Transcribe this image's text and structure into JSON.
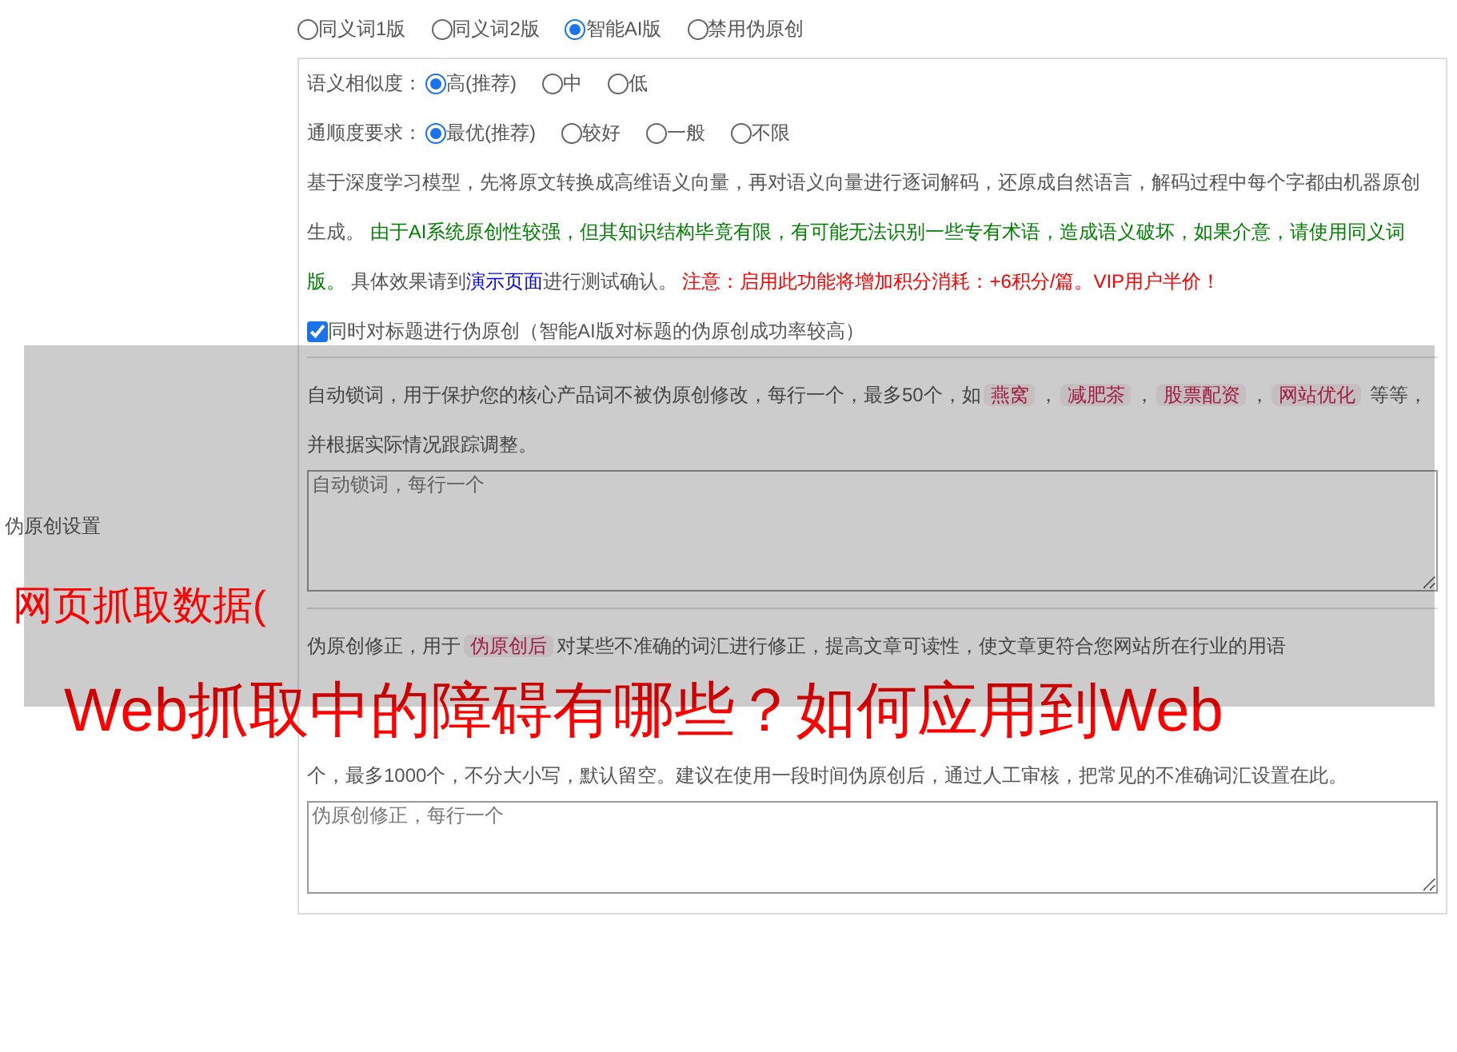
{
  "label": "伪原创设置",
  "modes": [
    {
      "label": "同义词1版",
      "selected": false
    },
    {
      "label": "同义词2版",
      "selected": false
    },
    {
      "label": "智能AI版",
      "selected": true
    },
    {
      "label": "禁用伪原创",
      "selected": false
    }
  ],
  "similarity": {
    "label": "语义相似度：",
    "options": [
      {
        "label": "高(推荐)",
        "selected": true
      },
      {
        "label": "中",
        "selected": false
      },
      {
        "label": "低",
        "selected": false
      }
    ]
  },
  "fluency": {
    "label": "通顺度要求：",
    "options": [
      {
        "label": "最优(推荐)",
        "selected": true
      },
      {
        "label": "较好",
        "selected": false
      },
      {
        "label": "一般",
        "selected": false
      },
      {
        "label": "不限",
        "selected": false
      }
    ]
  },
  "description": [
    {
      "kind": "plain",
      "text": "基于深度学习模型，先将原文转换成高维语义向量，再对语义向量进行逐词解码，还原成自然语言，解码过程中每个字都由机器原创生成。 "
    },
    {
      "kind": "green",
      "text": "由于AI系统原创性较强，但其知识结构毕竟有限，有可能无法识别一些专有术语，造成语义破坏，如果介意，请使用同义词版。"
    },
    {
      "kind": "plain",
      "text": " 具体效果请到"
    },
    {
      "kind": "link",
      "text": "演示页面"
    },
    {
      "kind": "plain",
      "text": "进行测试确认。 "
    },
    {
      "kind": "red",
      "text": "注意：启用此功能将增加积分消耗：+6积分/篇。VIP用户半价！"
    }
  ],
  "title_option": {
    "label": "同时对标题进行伪原创（智能AI版对标题的伪原创成功率较高）",
    "checked": true
  },
  "lock_words": {
    "segments": [
      {
        "kind": "plain",
        "text": "自动锁词，用于保护您的核心产品词不被伪原创修改，每行一个，最多50个，如"
      },
      {
        "kind": "tag",
        "text": "燕窝"
      },
      {
        "kind": "plain",
        "text": "，"
      },
      {
        "kind": "tag",
        "text": "减肥茶"
      },
      {
        "kind": "plain",
        "text": "，"
      },
      {
        "kind": "tag",
        "text": "股票配资"
      },
      {
        "kind": "plain",
        "text": "，"
      },
      {
        "kind": "tag",
        "text": "网站优化"
      },
      {
        "kind": "plain",
        "text": " 等等，并根据实际情况跟踪调整。"
      }
    ],
    "placeholder": "自动锁词，每行一个"
  },
  "correction": {
    "segments": [
      {
        "kind": "plain",
        "text": "伪原创修正，用于"
      },
      {
        "kind": "tag",
        "text": "伪原创后"
      },
      {
        "kind": "plain",
        "text": "对某些不准确的词汇进行修正，提高文章可读性，使文章更符合您网站所在行业的用语"
      }
    ],
    "continuation": "个，最多1000个，不分大小写，默认留空。建议在使用一段时间伪原创后，通过人工审核，把常见的不准确词汇设置在此。",
    "placeholder": "伪原创修正，每行一个"
  },
  "captions": [
    "网页抓取数据(",
    "Web抓取中的障碍有哪些？如何应用到Web"
  ]
}
